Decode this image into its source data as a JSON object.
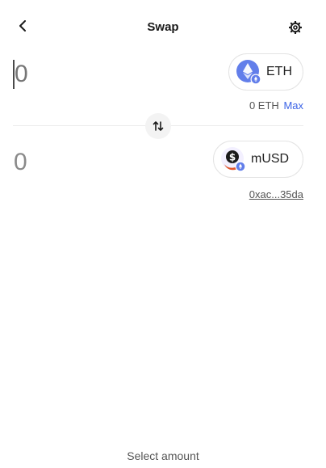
{
  "header": {
    "title": "Swap",
    "back_icon": "chevron-left-icon",
    "settings_icon": "gear-icon"
  },
  "from": {
    "amount": "0",
    "token_symbol": "ETH",
    "balance": "0 ETH",
    "max_label": "Max"
  },
  "to": {
    "amount": "0",
    "token_symbol": "mUSD",
    "address": "0xac...35da"
  },
  "switch_icon": "swap-arrows-icon",
  "footer": {
    "action_label": "Select amount"
  },
  "colors": {
    "accent": "#3c64e6",
    "eth": "#627eea",
    "musd": "#1a1a1a",
    "text_muted": "#8a8a8a"
  }
}
